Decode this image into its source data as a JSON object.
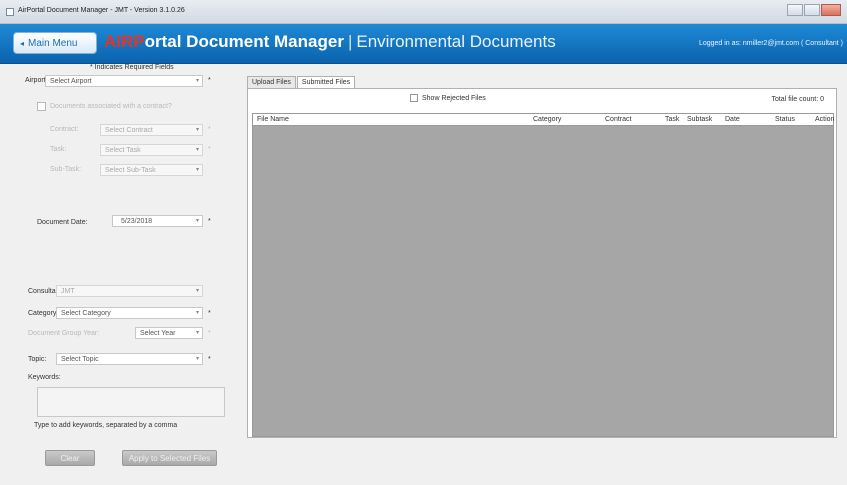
{
  "window": {
    "title": "AirPortal Document Manager - JMT - Version 3.1.0.26"
  },
  "header": {
    "main_menu": "Main Menu",
    "title_air": "AIRP",
    "title_rest": "ortal Document Manager",
    "title_sep": "|",
    "title_env": "Environmental Documents",
    "logged_in": "Logged in as: nmiller2@jmt.com ( Consultant )"
  },
  "form": {
    "required_note": "* Indicates Required Fields",
    "airport_label": "Airport:",
    "airport_value": "Select Airport",
    "contract_assoc_label": "Documents associated with a contract?",
    "contract_label": "Contract:",
    "contract_value": "Select Contract",
    "task_label": "Task:",
    "task_value": "Select Task",
    "subtask_label": "Sub-Task:",
    "subtask_value": "Select Sub-Task",
    "doc_date_label": "Document Date:",
    "doc_date_value": "5/23/2018",
    "consultant_label": "Consultant:",
    "consultant_value": "JMT",
    "category_label": "Category:",
    "category_value": "Select Category",
    "group_year_label": "Document Group Year:",
    "group_year_value": "Select Year",
    "topic_label": "Topic:",
    "topic_value": "Select Topic",
    "keywords_label": "Keywords:",
    "keywords_hint": "Type to add keywords, separated by a comma",
    "clear_button": "Clear",
    "apply_button": "Apply to Selected Files",
    "asterisk": "*"
  },
  "tabs": [
    {
      "label": "Upload Files"
    },
    {
      "label": "Submitted Files"
    }
  ],
  "files": {
    "show_rejected": "Show Rejected Files",
    "total_count": "Total file count: 0",
    "columns": [
      "File Name",
      "Category",
      "Contract",
      "Task",
      "Subtask",
      "Date",
      "Status",
      "Action"
    ]
  },
  "colors": {
    "header_blue": "#1473c2",
    "brand_red": "#e53324"
  }
}
